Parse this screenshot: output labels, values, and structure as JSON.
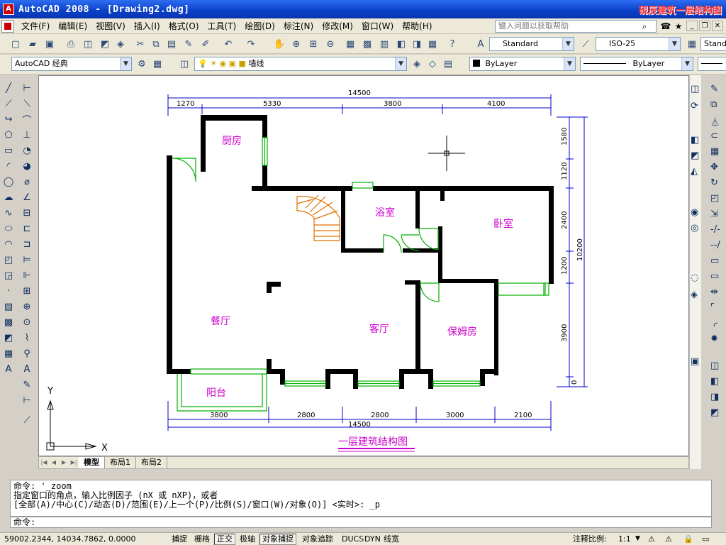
{
  "window": {
    "title": "AutoCAD 2008 - [Drawing2.dwg]",
    "brand": "砚辰建筑一层结构图"
  },
  "menu": {
    "items": [
      "文件(F)",
      "编辑(E)",
      "视图(V)",
      "插入(I)",
      "格式(O)",
      "工具(T)",
      "绘图(D)",
      "标注(N)",
      "修改(M)",
      "窗口(W)",
      "帮助(H)"
    ],
    "help_placeholder": "键入问题以获取帮助"
  },
  "toolbar": {
    "text_style": "Standard",
    "dim_style": "ISO-25",
    "table_style": "Stand",
    "workspace": "AutoCAD 经典",
    "layer": "墙线",
    "color": "ByLayer",
    "linetype": "ByLayer"
  },
  "drawing": {
    "rooms": [
      "厨房",
      "浴室",
      "卧室",
      "餐厅",
      "客厅",
      "保姆房",
      "阳台"
    ],
    "top_total": "14500",
    "top_dims": [
      "1270",
      "5330",
      "3800",
      "4100"
    ],
    "bottom_dims": [
      "3800",
      "2800",
      "2800",
      "3000",
      "2100"
    ],
    "bottom_total": "14500",
    "right_dims": [
      "1580",
      "1120",
      "2400",
      "1200",
      "3900",
      "0"
    ],
    "right_total": "10200",
    "caption": "一层建筑结构图",
    "ucs_x": "X",
    "ucs_y": "Y"
  },
  "tabs": [
    "模型",
    "布局1",
    "布局2"
  ],
  "command": {
    "history": [
      "命令: '_zoom",
      "指定窗口的角点，输入比例因子 (nX 或 nXP)，或者",
      "[全部(A)/中心(C)/动态(D)/范围(E)/上一个(P)/比例(S)/窗口(W)/对象(O)] <实时>: _p"
    ],
    "prompt": "命令:"
  },
  "status": {
    "coords": "59002.2344, 14034.7862, 0.0000",
    "buttons": [
      "捕捉",
      "栅格",
      "正交",
      "极轴",
      "对象捕捉",
      "对象追踪",
      "DUCS",
      "DYN",
      "线宽"
    ],
    "annotation_scale_label": "注释比例:",
    "annotation_scale": "1:1"
  },
  "colors": {
    "titlebar": "#0a3fc7",
    "wall": "#000000",
    "window": "#00b000",
    "door": "#00b000",
    "stair": "#e07000",
    "room_label": "#cc00cc",
    "dimension": "#0000cc",
    "caption": "#cc00cc"
  }
}
